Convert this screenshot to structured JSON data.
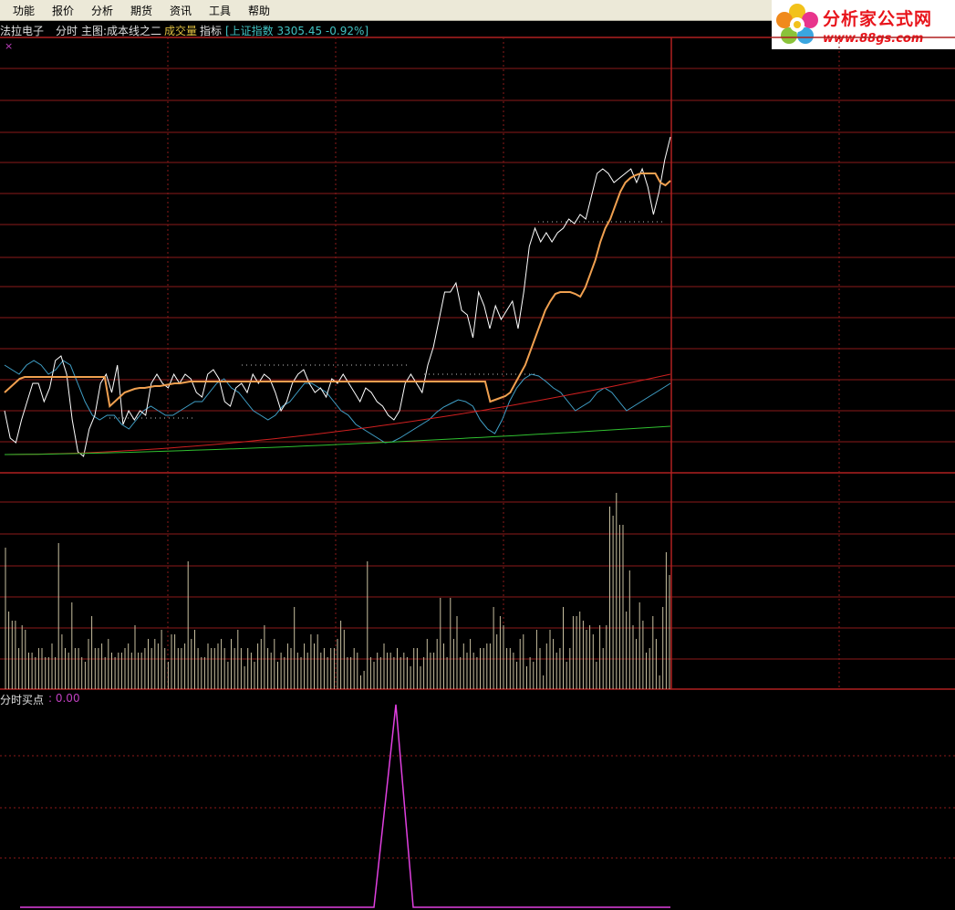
{
  "menu": {
    "items": [
      "功能",
      "报价",
      "分析",
      "期货",
      "资讯",
      "工具",
      "帮助"
    ]
  },
  "brand": {
    "title": "分析家公式网",
    "url": "www.88gs.com"
  },
  "infobar": {
    "stock_name": "法拉电子",
    "mode": "分时",
    "main_indicator": "主图:成本线之二",
    "volume_label": "成交量",
    "indicator_label": "指标",
    "index_text": "[上证指数 3305.45 -0.92%]"
  },
  "close_mark": "×",
  "sub_panel": {
    "label": "分时买点",
    "value": ": 0.00"
  },
  "colors": {
    "grid": "#8c1a1a",
    "price": "#ffffff",
    "avg": "#f0a050",
    "cyan": "#40a0c8",
    "red_line": "#d02020",
    "green_line": "#30c030",
    "volume": "#c8c0a0",
    "signal": "#e040e0",
    "index_text": "#40c0c0"
  },
  "chart_data": {
    "type": "line",
    "price": [
      450,
      480,
      485,
      460,
      440,
      420,
      420,
      440,
      425,
      395,
      390,
      410,
      460,
      495,
      500,
      470,
      455,
      420,
      410,
      430,
      400,
      465,
      450,
      460,
      450,
      455,
      420,
      410,
      420,
      425,
      410,
      420,
      410,
      415,
      430,
      435,
      410,
      405,
      415,
      440,
      445,
      425,
      420,
      430,
      410,
      420,
      410,
      415,
      430,
      450,
      440,
      420,
      410,
      405,
      420,
      430,
      425,
      435,
      415,
      420,
      410,
      420,
      430,
      440,
      425,
      430,
      440,
      445,
      455,
      460,
      450,
      420,
      410,
      420,
      430,
      400,
      380,
      350,
      320,
      320,
      310,
      340,
      345,
      370,
      320,
      335,
      360,
      335,
      350,
      340,
      330,
      360,
      320,
      270,
      250,
      265,
      255,
      265,
      255,
      250,
      240,
      245,
      235,
      240,
      215,
      190,
      185,
      190,
      200,
      195,
      190,
      185,
      200,
      185,
      205,
      235,
      210,
      175,
      150
    ],
    "avg": [
      430,
      425,
      420,
      415,
      413,
      413,
      413,
      413,
      413,
      413,
      413,
      413,
      413,
      413,
      413,
      413,
      413,
      413,
      413,
      413,
      413,
      445,
      440,
      435,
      430,
      428,
      426,
      425,
      425,
      424,
      423,
      423,
      422,
      421,
      420,
      420,
      419,
      418,
      418,
      418,
      418,
      418,
      418,
      418,
      418,
      418,
      418,
      418,
      418,
      418,
      418,
      418,
      418,
      418,
      418,
      418,
      418,
      418,
      418,
      418,
      418,
      418,
      418,
      418,
      418,
      418,
      418,
      418,
      418,
      418,
      418,
      418,
      418,
      418,
      418,
      418,
      418,
      418,
      418,
      418,
      418,
      418,
      418,
      418,
      418,
      418,
      418,
      418,
      418,
      418,
      418,
      418,
      418,
      418,
      418,
      418,
      418,
      440,
      438,
      436,
      434,
      430,
      420,
      410,
      400,
      385,
      370,
      355,
      340,
      330,
      322,
      320,
      320,
      320,
      322,
      325,
      315,
      300,
      285,
      265,
      250,
      240,
      225,
      210,
      200,
      195,
      192,
      190,
      190,
      190,
      190,
      200,
      203,
      198
    ],
    "cyan": [
      400,
      405,
      410,
      400,
      395,
      400,
      410,
      405,
      395,
      400,
      420,
      440,
      455,
      460,
      455,
      455,
      465,
      470,
      460,
      450,
      445,
      450,
      455,
      455,
      450,
      445,
      440,
      440,
      430,
      420,
      415,
      425,
      430,
      440,
      450,
      455,
      460,
      455,
      445,
      440,
      430,
      420,
      420,
      425,
      430,
      440,
      450,
      455,
      465,
      470,
      475,
      480,
      485,
      484,
      480,
      475,
      470,
      465,
      460,
      452,
      446,
      442,
      438,
      440,
      445,
      460,
      470,
      475,
      460,
      440,
      425,
      415,
      410,
      412,
      418,
      425,
      430,
      440,
      450,
      445,
      440,
      430,
      425,
      430,
      440,
      450,
      445,
      440,
      435,
      430,
      425,
      420
    ],
    "volume": [
      155,
      85,
      75,
      75,
      45,
      70,
      65,
      40,
      40,
      35,
      45,
      45,
      35,
      35,
      50,
      35,
      160,
      60,
      45,
      40,
      95,
      45,
      45,
      35,
      30,
      55,
      80,
      45,
      45,
      50,
      35,
      55,
      40,
      35,
      40,
      40,
      45,
      50,
      40,
      70,
      40,
      40,
      45,
      55,
      45,
      55,
      50,
      65,
      45,
      30,
      60,
      60,
      45,
      45,
      50,
      140,
      55,
      65,
      45,
      35,
      35,
      50,
      45,
      45,
      50,
      55,
      45,
      30,
      55,
      45,
      65,
      45,
      25,
      45,
      40,
      30,
      50,
      55,
      70,
      45,
      40,
      55,
      30,
      40,
      35,
      50,
      45,
      90,
      40,
      35,
      50,
      40,
      60,
      50,
      60,
      40,
      45,
      35,
      45,
      45,
      55,
      75,
      65,
      35,
      35,
      45,
      40,
      15,
      20,
      140,
      35,
      30,
      40,
      35,
      50,
      40,
      40,
      35,
      45,
      35,
      40,
      35,
      25,
      45,
      45,
      25,
      35,
      55,
      40,
      40,
      55,
      100,
      50,
      35,
      100,
      55,
      80,
      35,
      50,
      40,
      55,
      40,
      35,
      45,
      45,
      50,
      50,
      90,
      60,
      80,
      70,
      45,
      45,
      40,
      30,
      55,
      60,
      25,
      35,
      30,
      65,
      45,
      15,
      50,
      65,
      55,
      40,
      45,
      90,
      30,
      45,
      80,
      80,
      85,
      75,
      65,
      70,
      60,
      30,
      70,
      45,
      70,
      200,
      190,
      215,
      180,
      180,
      85,
      130,
      70,
      55,
      95,
      75,
      40,
      45,
      80,
      55,
      15,
      90,
      150,
      125
    ]
  }
}
